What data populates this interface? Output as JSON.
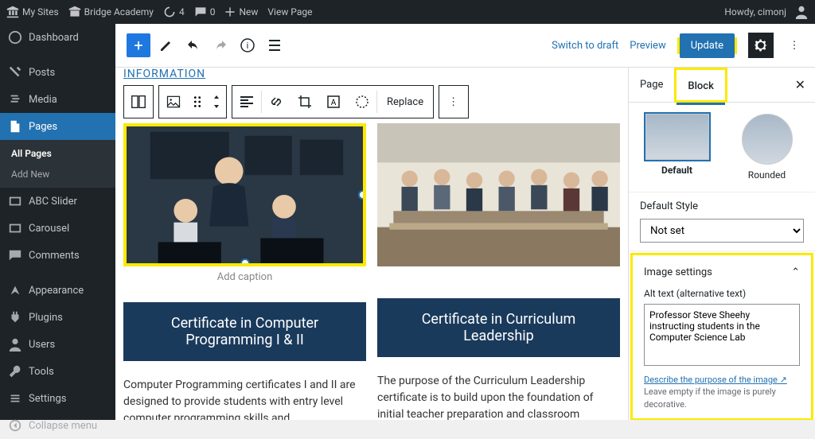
{
  "adminbar": {
    "mysites": "My Sites",
    "sitename": "Bridge Academy",
    "updates": "4",
    "comments": "0",
    "new": "New",
    "viewpage": "View Page",
    "howdy": "Howdy, cimonj"
  },
  "sidebar": {
    "dashboard": "Dashboard",
    "posts": "Posts",
    "media": "Media",
    "pages": "Pages",
    "allpages": "All Pages",
    "addnew": "Add New",
    "abcslider": "ABC Slider",
    "carousel": "Carousel",
    "comments": "Comments",
    "appearance": "Appearance",
    "plugins": "Plugins",
    "users": "Users",
    "tools": "Tools",
    "settings": "Settings",
    "collapse": "Collapse menu"
  },
  "toolbar": {
    "switch": "Switch to draft",
    "preview": "Preview",
    "update": "Update"
  },
  "canvas": {
    "infolink": "INFORMATION",
    "replace": "Replace",
    "caption": "Add caption",
    "cert1_l1": "Certificate in Computer",
    "cert1_l2": "Programming I & II",
    "cert2_l1": "Certificate in Curriculum",
    "cert2_l2": "Leadership",
    "body1": "Computer Programming certificates I and II are designed to provide students with entry level computer programming skills and",
    "body2": "The purpose of the Curriculum Leadership certificate is to build upon the foundation of initial teacher preparation and classroom experience to support in service teachers with"
  },
  "settings": {
    "page": "Page",
    "block": "Block",
    "style_default": "Default",
    "style_rounded": "Rounded",
    "defstyle_label": "Default Style",
    "defstyle_value": "Not set",
    "imgset_title": "Image settings",
    "alt_label": "Alt text (alternative text)",
    "alt_value": "Professor Steve Sheehy instructing students in the Computer Science Lab",
    "help_link": "Describe the purpose of the image",
    "help_rest": " Leave empty if the image is purely decorative."
  }
}
